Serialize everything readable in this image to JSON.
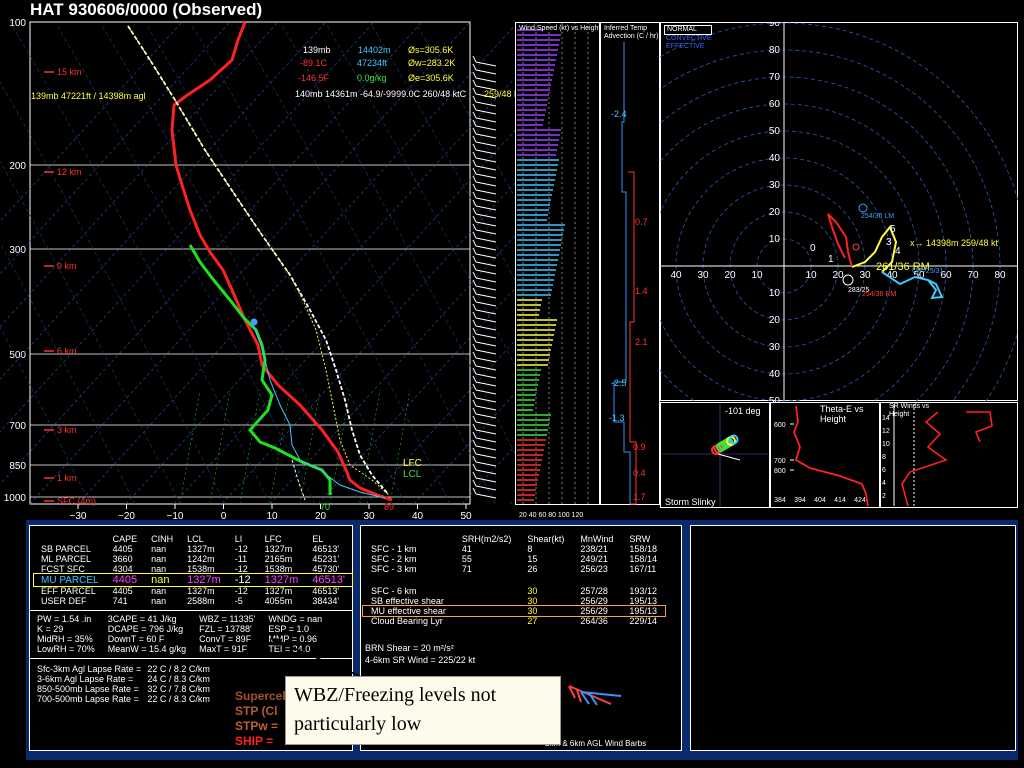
{
  "header": {
    "title": "HAT   930606/0000  (Observed)"
  },
  "chart_data": [
    {
      "type": "line",
      "title": "Skew-T",
      "pressure_ticks": [
        "100",
        "200",
        "300",
        "500",
        "700",
        "850",
        "1000"
      ],
      "temp_ticks": [
        "−30",
        "−20",
        "−10",
        "0",
        "10",
        "20",
        "30",
        "40",
        "50"
      ],
      "height_labels": [
        "15 km",
        "12 km",
        "9 km",
        "6 km",
        "3 km",
        "1 km",
        "SFC (4m)"
      ],
      "surface_labels": {
        "dewpoint": "70",
        "temperature": "89"
      },
      "level_labels": [
        "LFC",
        "LCL"
      ],
      "cursor_readout": {
        "line1": [
          "139mb",
          "14402m",
          "Øs=305.6K"
        ],
        "line2": [
          "-89.1C",
          "47234ft",
          "Øw=283.2K"
        ],
        "line3": [
          "-146.5F",
          "0.0g/kg",
          "Øe=305.6K"
        ],
        "line4": "140mb  14361m  -64.9/-9999.0C  260/48 ktC",
        "line4_wind": "259/48 kt",
        "left_label": "139mb  47221ft / 14398m agl"
      },
      "series": [
        {
          "name": "temperature",
          "color": "#ff2020"
        },
        {
          "name": "dewpoint",
          "color": "#20e020"
        },
        {
          "name": "parcel",
          "color": "#ffffff"
        }
      ]
    },
    {
      "type": "bar",
      "title": "Wind Speed (kt) vs Height",
      "x_ticks": [
        "20",
        "40",
        "60",
        "80",
        "100",
        "120"
      ]
    },
    {
      "type": "line",
      "title": "Inferred Temp Advection (C / hr)",
      "labels": [
        "-2.4",
        "0.7",
        "1.4",
        "2.1",
        "-2.5",
        "-1.3",
        "0.9",
        "0.4",
        "1.7"
      ]
    },
    {
      "type": "scatter",
      "title": "Hodograph",
      "legend": [
        "NORMAL",
        "CONVECTIVE",
        "EFFECTIVE"
      ],
      "y_ticks": [
        "90",
        "80",
        "70",
        "60",
        "50",
        "40",
        "30",
        "20",
        "10",
        "10",
        "20",
        "30",
        "40",
        "50"
      ],
      "x_ticks": [
        "40",
        "30",
        "20",
        "10",
        "10",
        "20",
        "30",
        "40",
        "50",
        "60",
        "70",
        "80"
      ],
      "labels": {
        "lm": "254/36 LM",
        "cursor": "x→ 14398m  259/48 kt",
        "storm": "261/36 RM",
        "up": "UP=25/31",
        "mean": "283/25",
        "rm": "254/36 RM",
        "numbers": [
          "0",
          "1",
          "3",
          "4",
          "5"
        ]
      }
    },
    {
      "type": "line",
      "title": "Storm Slinky",
      "label": "-101 deg"
    },
    {
      "type": "line",
      "title": "Theta-E vs Height",
      "y_ticks": [
        "600",
        "700",
        "800"
      ],
      "x_ticks": [
        "384",
        "394",
        "404",
        "414",
        "424"
      ]
    },
    {
      "type": "line",
      "title": "SR Winds vs Height",
      "y_ticks": [
        "14",
        "12",
        "10",
        "8",
        "6",
        "4",
        "2"
      ]
    }
  ],
  "parcel_table": {
    "headers": [
      "",
      "CAPE",
      "CINH",
      "LCL",
      "LI",
      "LFC",
      "EL"
    ],
    "rows": [
      [
        "SB PARCEL",
        "4405",
        "nan",
        "1327m",
        "-12",
        "1327m",
        "46513'"
      ],
      [
        "ML PARCEL",
        "3660",
        "nan",
        "1242m",
        "-11",
        "2165m",
        "45231'"
      ],
      [
        "FCST SFC",
        "4304",
        "nan",
        "1538m",
        "-12",
        "1538m",
        "45730'"
      ],
      [
        "MU PARCEL",
        "4405",
        "nan",
        "1327m",
        "-12",
        "1327m",
        "46513'"
      ],
      [
        "EFF PARCEL",
        "4405",
        "nan",
        "1327m",
        "-12",
        "1327m",
        "46513'"
      ],
      [
        "USER DEF",
        "741",
        "nan",
        "2588m",
        "-5",
        "4055m",
        "38434'"
      ]
    ]
  },
  "thermo_indices": [
    [
      "PW = 1.54 .in",
      "3CAPE = 41 J/kg",
      "WBZ = 11335'",
      "WNDG = nan"
    ],
    [
      "K = 29",
      "DCAPE = 796 J/kg",
      "FZL = 13788'",
      "ESP = 1.0"
    ],
    [
      "MidRH = 35%",
      "DownT = 60 F",
      "ConvT = 89F",
      "MMP = 0.96"
    ],
    [
      "LowRH = 70%",
      "MeanW = 15.4 g/kg",
      "MaxT = 91F",
      "TEI = 34.0"
    ]
  ],
  "lapse_rates": [
    [
      "Sfc-3km Agl Lapse Rate =",
      "22 C / 8.2 C/km"
    ],
    [
      "3-6km Agl Lapse Rate =",
      "24 C / 8.3 C/km"
    ],
    [
      "850-500mb Lapse Rate =",
      "32 C / 7.8 C/km"
    ],
    [
      "700-500mb Lapse Rate =",
      "22 C / 8.3 C/km"
    ]
  ],
  "composite": [
    "Supercell",
    "STP (Cl",
    "STPw =",
    "SHIP ="
  ],
  "kinematic_table": {
    "headers": [
      "",
      "SRH(m2/s2)",
      "Shear(kt)",
      "MnWind",
      "SRW"
    ],
    "rows": [
      [
        "SFC - 1 km",
        "41",
        "8",
        "238/21",
        "158/18"
      ],
      [
        "SFC - 2 km",
        "55",
        "15",
        "249/21",
        "158/14"
      ],
      [
        "SFC - 3 km",
        "71",
        "26",
        "256/23",
        "167/11"
      ],
      [
        "",
        "",
        "",
        "",
        ""
      ],
      [
        "SFC - 6 km",
        "",
        "30",
        "257/28",
        "193/12"
      ],
      [
        "SB effective shear",
        "",
        "30",
        "256/29",
        "195/13"
      ],
      [
        "MU effective shear",
        "",
        "30",
        "256/29",
        "195/13"
      ],
      [
        "Cloud Bearing Lyr",
        "",
        "27",
        "264/36",
        "229/14"
      ]
    ]
  },
  "kinematic_extra": {
    "brn": "BRN Shear =  20 m²/s²",
    "sr_wind": "4-6km SR Wind =          225/22 kt",
    "barbs_caption": "2km & 6km AGL Wind Barbs"
  },
  "callout": {
    "text": "WBZ/Freezing levels not particularly low"
  },
  "colors": {
    "temperature": "#ff2020",
    "dewpoint": "#20e020",
    "wetbulb": "#40c8ff",
    "parcel": "#ffffff",
    "mu_row": "#ff40ff",
    "accent": "#ffff40"
  }
}
